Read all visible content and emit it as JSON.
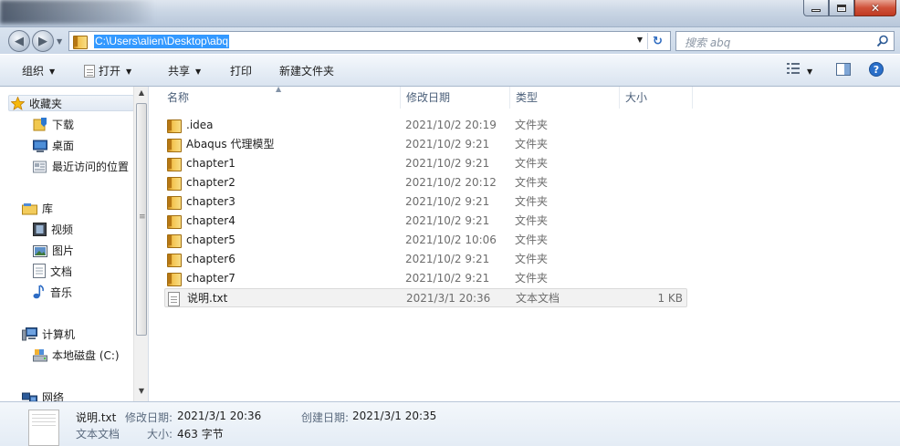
{
  "window": {
    "controls": {
      "minimize": "minimize",
      "maximize": "maximize",
      "close": "close"
    }
  },
  "address": {
    "path": "C:\\Users\\alien\\Desktop\\abq",
    "search_placeholder": "搜索 abq"
  },
  "toolbar": {
    "organize": "组织",
    "open": "打开",
    "share": "共享",
    "print": "打印",
    "new_folder": "新建文件夹"
  },
  "sidebar": {
    "favorites": "收藏夹",
    "downloads": "下载",
    "desktop": "桌面",
    "recent": "最近访问的位置",
    "libraries": "库",
    "videos": "视频",
    "pictures": "图片",
    "documents": "文档",
    "music": "音乐",
    "computer": "计算机",
    "local_disk": "本地磁盘 (C:)",
    "network": "网络"
  },
  "columns": {
    "name": "名称",
    "date": "修改日期",
    "type": "类型",
    "size": "大小"
  },
  "files": [
    {
      "name": ".idea",
      "date": "2021/10/2 20:19",
      "type": "文件夹",
      "size": "",
      "icon": "folder-icon"
    },
    {
      "name": "Abaqus 代理模型",
      "date": "2021/10/2 9:21",
      "type": "文件夹",
      "size": "",
      "icon": "folder-icon"
    },
    {
      "name": "chapter1",
      "date": "2021/10/2 9:21",
      "type": "文件夹",
      "size": "",
      "icon": "folder-icon"
    },
    {
      "name": "chapter2",
      "date": "2021/10/2 20:12",
      "type": "文件夹",
      "size": "",
      "icon": "folder-icon"
    },
    {
      "name": "chapter3",
      "date": "2021/10/2 9:21",
      "type": "文件夹",
      "size": "",
      "icon": "folder-icon"
    },
    {
      "name": "chapter4",
      "date": "2021/10/2 9:21",
      "type": "文件夹",
      "size": "",
      "icon": "folder-icon"
    },
    {
      "name": "chapter5",
      "date": "2021/10/2 10:06",
      "type": "文件夹",
      "size": "",
      "icon": "folder-icon"
    },
    {
      "name": "chapter6",
      "date": "2021/10/2 9:21",
      "type": "文件夹",
      "size": "",
      "icon": "folder-icon"
    },
    {
      "name": "chapter7",
      "date": "2021/10/2 9:21",
      "type": "文件夹",
      "size": "",
      "icon": "folder-icon"
    },
    {
      "name": "说明.txt",
      "date": "2021/3/1 20:36",
      "type": "文本文档",
      "size": "1 KB",
      "icon": "text-file-icon",
      "selected": true
    }
  ],
  "details": {
    "filename": "说明.txt",
    "type": "文本文档",
    "modified_label": "修改日期:",
    "modified_value": "2021/3/1 20:36",
    "created_label": "创建日期:",
    "created_value": "2021/3/1 20:35",
    "size_label": "大小:",
    "size_value": "463 字节"
  },
  "colors": {
    "selection_blue": "#3399ff",
    "header_text": "#4c607a",
    "secondary_text": "#6d6d6d"
  }
}
